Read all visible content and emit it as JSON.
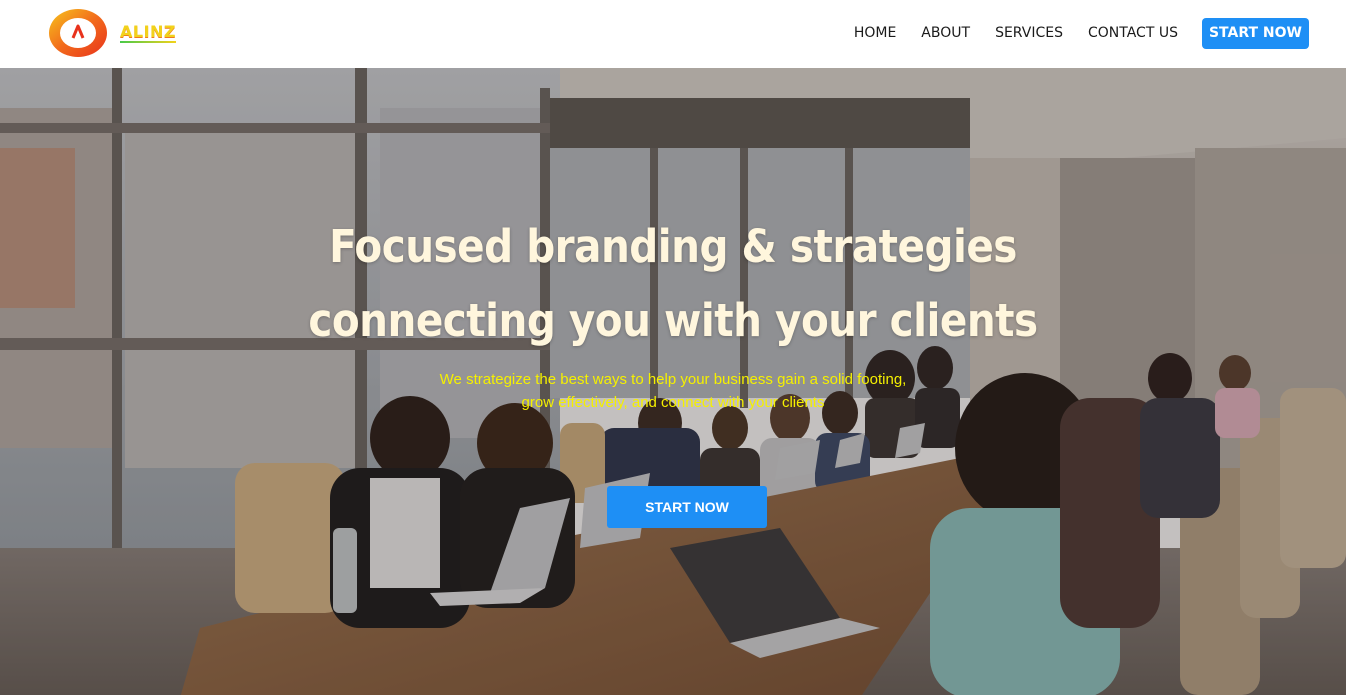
{
  "brand": {
    "name": "ALINZ",
    "logo_icon": "circle-a-logo-icon"
  },
  "nav": {
    "links": [
      "HOME",
      "ABOUT",
      "SERVICES",
      "CONTACT US"
    ],
    "cta_label": "START NOW"
  },
  "hero": {
    "title_line1": "Focused branding & strategies",
    "title_line2": "connecting you with your clients",
    "subtitle_line1": "We strategize the best ways to help your business gain a solid footing,",
    "subtitle_line2": "grow effectively, and connect with your clients",
    "cta_label": "START NOW",
    "background": "meeting-room-photo"
  },
  "colors": {
    "accent": "#1e8ff5",
    "title": "#fff6dd",
    "subtitle": "#f5f000",
    "nav_text": "#1b1b1b"
  }
}
